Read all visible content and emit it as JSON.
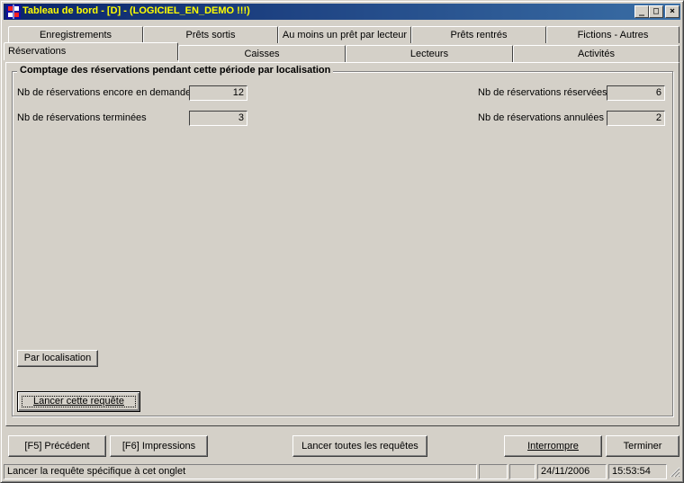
{
  "window": {
    "title": "Tableau de bord  - [D] - (LOGICIEL_EN_DEMO !!!)",
    "controls": [
      "_",
      "□",
      "×"
    ]
  },
  "tabs": {
    "row1": [
      "Enregistrements",
      "Prêts sortis",
      "Au moins un prêt par lecteur",
      "Prêts rentrés",
      "Fictions - Autres"
    ],
    "row2": [
      "Réservations",
      "Caisses",
      "Lecteurs",
      "Activités"
    ],
    "active": "Réservations"
  },
  "group": {
    "title": "Comptage des réservations pendant cette période par localisation"
  },
  "stats": {
    "en_demande_label": "Nb de réservations encore en demande",
    "en_demande_value": "12",
    "terminees_label": "Nb de réservations terminées",
    "terminees_value": "3",
    "reservees_label": "Nb de réservations réservées",
    "reservees_value": "6",
    "annulees_label": "Nb de réservations annulées",
    "annulees_value": "2"
  },
  "buttons": {
    "par_localisation": "Par localisation",
    "lancer_requete": "Lancer cette requête",
    "precedent": "[F5] Précédent",
    "impressions": "[F6] Impressions",
    "lancer_toutes": "Lancer toutes les requêtes",
    "interrompre": "Interrompre",
    "terminer": "Terminer"
  },
  "status": {
    "message": "Lancer la requête spécifique à cet onglet",
    "date": "24/11/2006",
    "time": "15:53:54"
  },
  "colors": {
    "title_gradient_start": "#0a246a",
    "title_gradient_end": "#3a6ea5",
    "title_text": "#ffff00",
    "face": "#d4d0c8"
  }
}
